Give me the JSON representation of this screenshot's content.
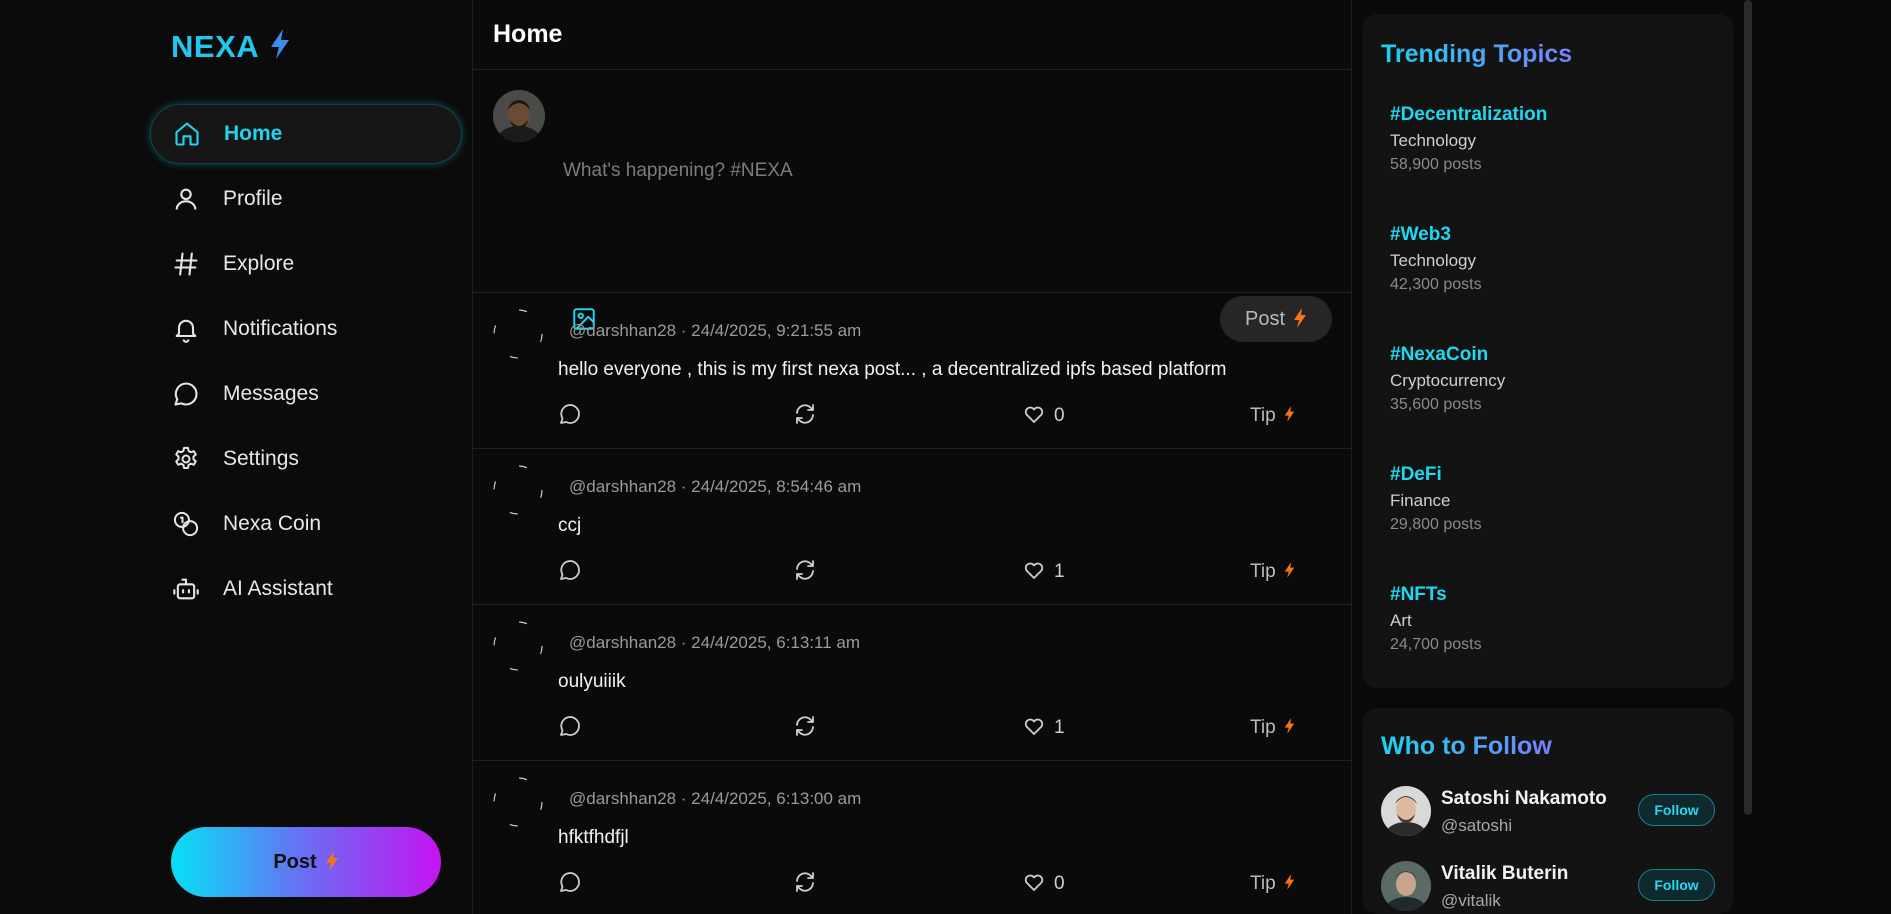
{
  "brand": {
    "name": "NEXA",
    "icon": "lightning-bolt-icon",
    "accent": "#22c7ee"
  },
  "nav": [
    {
      "label": "Home",
      "icon": "home-icon",
      "active": true
    },
    {
      "label": "Profile",
      "icon": "user-icon"
    },
    {
      "label": "Explore",
      "icon": "hashtag-icon"
    },
    {
      "label": "Notifications",
      "icon": "bell-icon"
    },
    {
      "label": "Messages",
      "icon": "chat-bubble-icon"
    },
    {
      "label": "Settings",
      "icon": "gear-icon"
    },
    {
      "label": "Nexa Coin",
      "icon": "coins-icon"
    },
    {
      "label": "AI Assistant",
      "icon": "robot-icon"
    }
  ],
  "sidebar_post_label": "Post",
  "feed": {
    "title": "Home",
    "composer": {
      "placeholder": "What's happening? #NEXA",
      "post_label": "Post"
    },
    "posts": [
      {
        "meta": "@darshhan28 · 24/4/2025, 9:21:55 am",
        "text": "hello everyone , this is my first nexa post... , a decentralized ipfs based platform",
        "likes": "0",
        "tip": "Tip"
      },
      {
        "meta": "@darshhan28 · 24/4/2025, 8:54:46 am",
        "text": "ccj",
        "likes": "1",
        "tip": "Tip"
      },
      {
        "meta": "@darshhan28 · 24/4/2025, 6:13:11 am",
        "text": "oulyuiiik",
        "likes": "1",
        "tip": "Tip"
      },
      {
        "meta": "@darshhan28 · 24/4/2025, 6:13:00 am",
        "text": "hfktfhdfjl",
        "likes": "0",
        "tip": "Tip"
      }
    ]
  },
  "trending": {
    "title": "Trending Topics",
    "topics": [
      {
        "tag": "#Decentralization",
        "category": "Technology",
        "count": "58,900 posts"
      },
      {
        "tag": "#Web3",
        "category": "Technology",
        "count": "42,300 posts"
      },
      {
        "tag": "#NexaCoin",
        "category": "Cryptocurrency",
        "count": "35,600 posts"
      },
      {
        "tag": "#DeFi",
        "category": "Finance",
        "count": "29,800 posts"
      },
      {
        "tag": "#NFTs",
        "category": "Art",
        "count": "24,700 posts"
      }
    ]
  },
  "who_to_follow": {
    "title": "Who to Follow",
    "users": [
      {
        "name": "Satoshi Nakamoto",
        "handle": "@satoshi",
        "button": "Follow"
      },
      {
        "name": "Vitalik Buterin",
        "handle": "@vitalik",
        "button": "Follow"
      }
    ]
  },
  "colors": {
    "accent": "#22d3ee",
    "bolt": "#f97316",
    "gradient_start": "#06e0f5",
    "gradient_end": "#c513f2"
  }
}
